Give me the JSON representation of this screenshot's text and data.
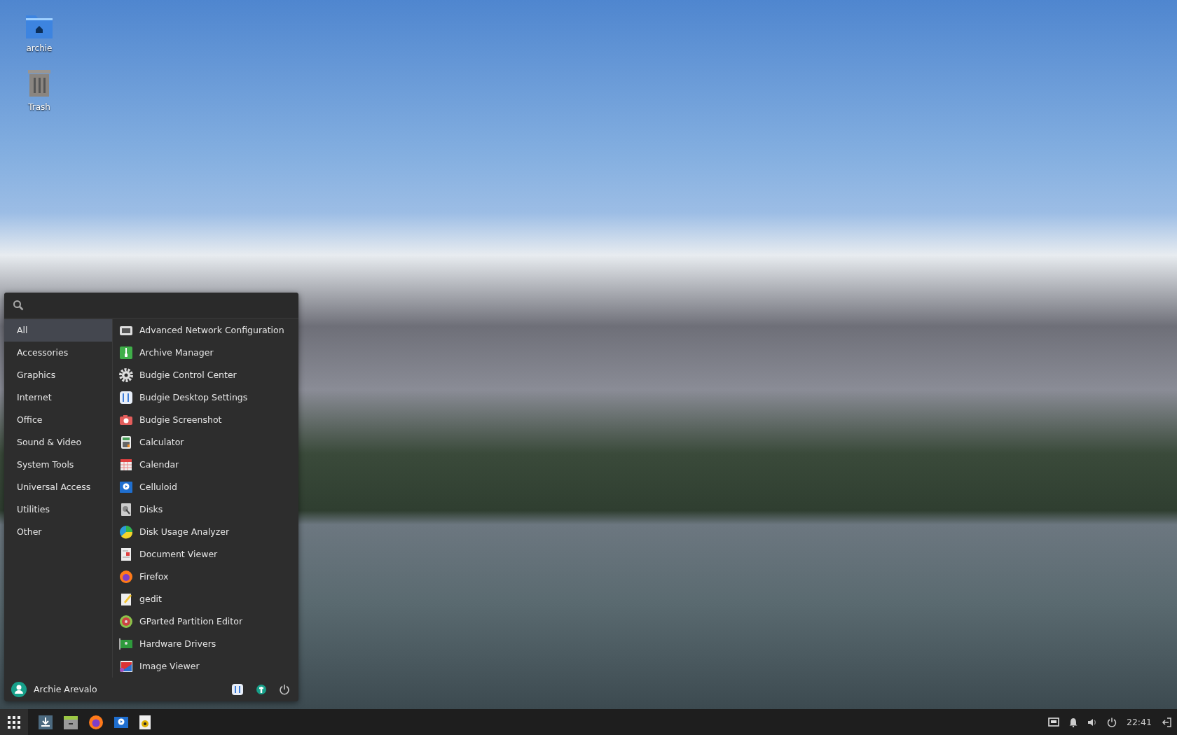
{
  "desktop_icons": [
    {
      "label": "archie"
    },
    {
      "label": "Trash"
    }
  ],
  "menu": {
    "categories": [
      {
        "label": "All",
        "selected": true
      },
      {
        "label": "Accessories",
        "selected": false
      },
      {
        "label": "Graphics",
        "selected": false
      },
      {
        "label": "Internet",
        "selected": false
      },
      {
        "label": "Office",
        "selected": false
      },
      {
        "label": "Sound & Video",
        "selected": false
      },
      {
        "label": "System Tools",
        "selected": false
      },
      {
        "label": "Universal Access",
        "selected": false
      },
      {
        "label": "Utilities",
        "selected": false
      },
      {
        "label": "Other",
        "selected": false
      }
    ],
    "apps": [
      {
        "label": "Advanced Network Configuration"
      },
      {
        "label": "Archive Manager"
      },
      {
        "label": "Budgie Control Center"
      },
      {
        "label": "Budgie Desktop Settings"
      },
      {
        "label": "Budgie Screenshot"
      },
      {
        "label": "Calculator"
      },
      {
        "label": "Calendar"
      },
      {
        "label": "Celluloid"
      },
      {
        "label": "Disks"
      },
      {
        "label": "Disk Usage Analyzer"
      },
      {
        "label": "Document Viewer"
      },
      {
        "label": "Firefox"
      },
      {
        "label": "gedit"
      },
      {
        "label": "GParted Partition Editor"
      },
      {
        "label": "Hardware Drivers"
      },
      {
        "label": "Image Viewer"
      }
    ],
    "user": "Archie Arevalo"
  },
  "taskbar": {
    "clock": "22:41"
  }
}
